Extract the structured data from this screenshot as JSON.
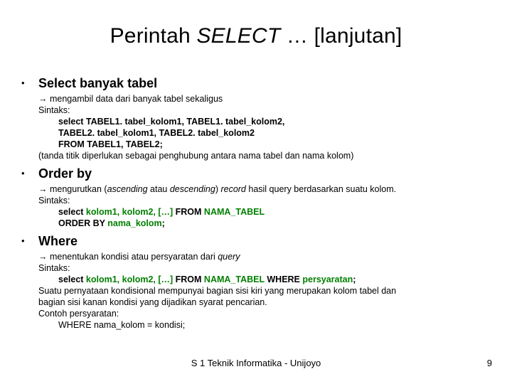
{
  "title": {
    "pre": "Perintah ",
    "italic": "SELECT",
    "post": " … [lanjutan]"
  },
  "sections": [
    {
      "heading": "Select banyak tabel",
      "arrow_line": "→ mengambil data dari banyak tabel sekaligus",
      "sintaks_label": "Sintaks:",
      "code_lines": [
        "select TABEL1. tabel_kolom1, TABEL1. tabel_kolom2,",
        "TABEL2. tabel_kolom1, TABEL2. tabel_kolom2",
        "FROM TABEL1, TABEL2;"
      ],
      "tail_lines": [
        "(tanda titik diperlukan sebagai penghubung antara nama tabel dan nama kolom)"
      ]
    },
    {
      "heading": "Order by",
      "arrow_pre": "→ mengurutkan (",
      "arrow_it1": "ascending",
      "arrow_mid": " atau ",
      "arrow_it2": "descending",
      "arrow_post1": ") ",
      "arrow_it3": "record",
      "arrow_post2": " hasil query berdasarkan suatu kolom.",
      "sintaks_label": "Sintaks:",
      "code_rich": [
        {
          "plain": "select ",
          "green": "kolom1, kolom2, […]",
          "plain2": " FROM ",
          "green2": "NAMA_TABEL"
        },
        {
          "plain": "ORDER BY ",
          "green": "nama_kolom",
          "plain2": ";"
        }
      ]
    },
    {
      "heading": "Where",
      "arrow_pre": "→ menentukan kondisi atau persyaratan dari ",
      "arrow_it1": "query",
      "sintaks_label": "Sintaks:",
      "code_rich": [
        {
          "plain": "select ",
          "green": "kolom1, kolom2, […]",
          "plain2": " FROM ",
          "green2": "NAMA_TABEL",
          "plain3": " WHERE ",
          "green3": "persyaratan",
          "plain4": ";"
        }
      ],
      "tail_lines": [
        "Suatu pernyataan kondisional mempunyai bagian sisi kiri yang merupakan kolom tabel dan",
        "bagian sisi kanan kondisi yang dijadikan syarat pencarian.",
        "Contoh persyaratan:"
      ],
      "tail_code": "WHERE nama_kolom = kondisi;"
    }
  ],
  "footer": "S 1 Teknik Informatika - Unijoyo",
  "page_number": "9"
}
